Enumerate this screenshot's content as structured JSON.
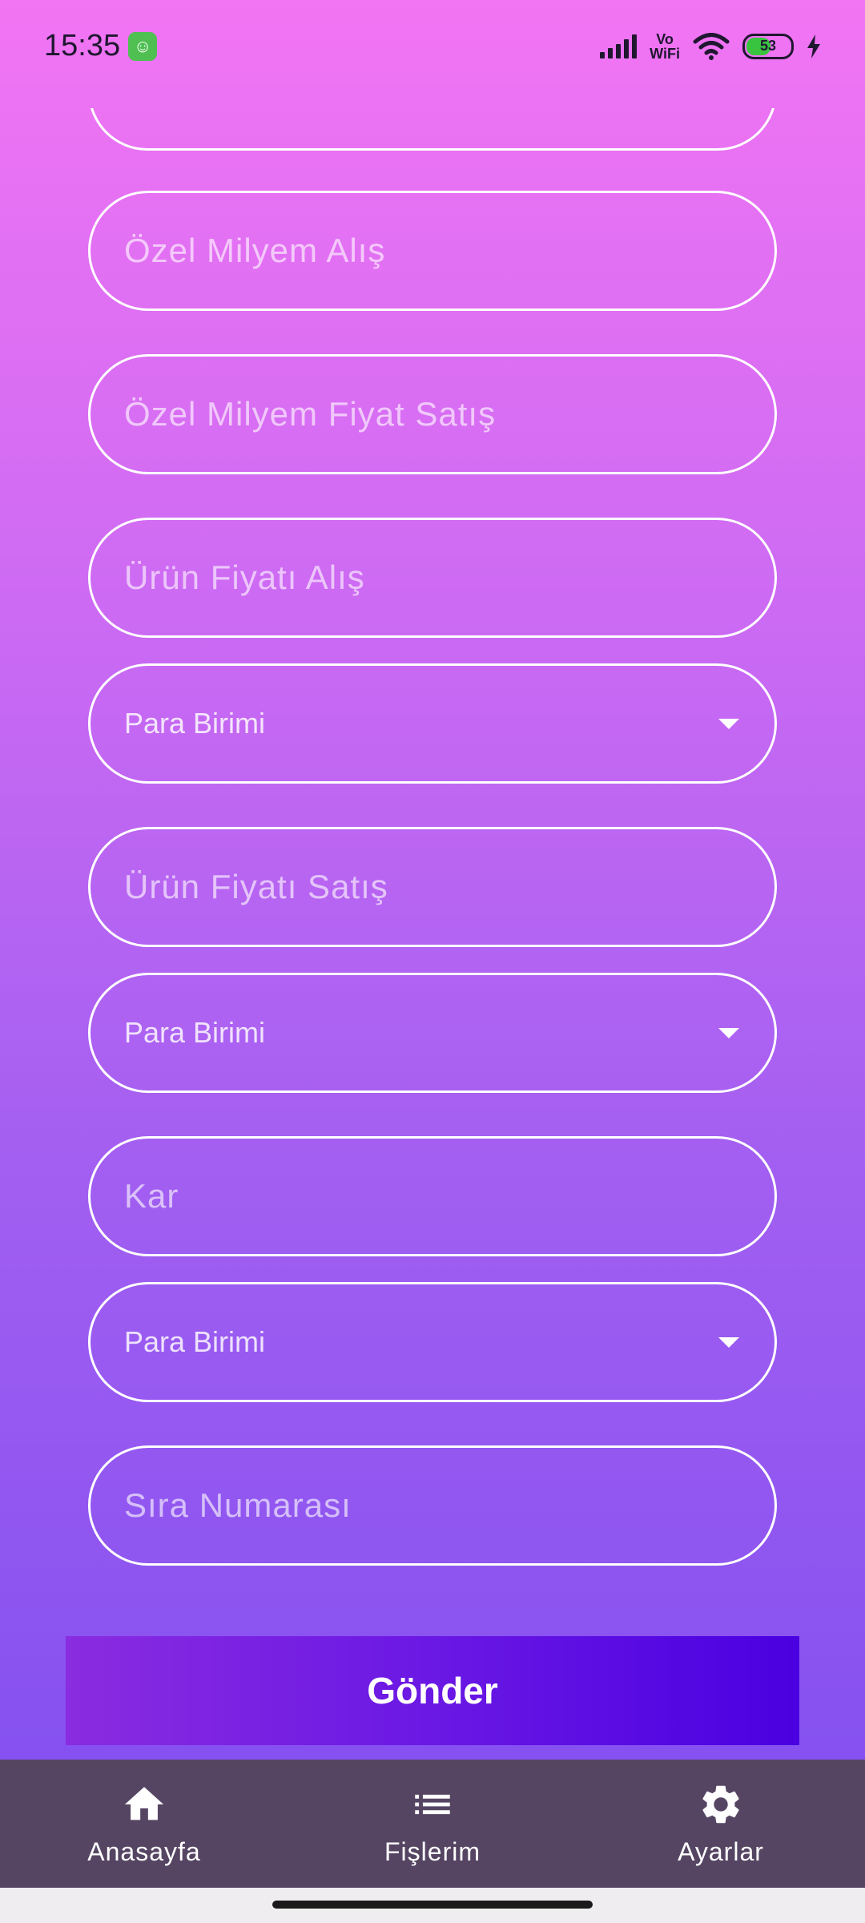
{
  "status_bar": {
    "time": "15:35",
    "net_top": "Vo",
    "net_bottom": "WiFi",
    "battery": "53"
  },
  "fields": [
    {
      "type": "text",
      "placeholder": "Özel Milyem Alış"
    },
    {
      "type": "text",
      "placeholder": "Özel Milyem Fiyat Satış"
    },
    {
      "type": "text",
      "placeholder": "Ürün Fiyatı Alış"
    },
    {
      "type": "dropdown",
      "placeholder": "Para Birimi"
    },
    {
      "type": "text",
      "placeholder": "Ürün Fiyatı Satış"
    },
    {
      "type": "dropdown",
      "placeholder": "Para Birimi"
    },
    {
      "type": "text",
      "placeholder": "Kar"
    },
    {
      "type": "dropdown",
      "placeholder": "Para Birimi"
    },
    {
      "type": "text",
      "placeholder": "Sıra Numarası"
    }
  ],
  "submit_label": "Gönder",
  "nav": [
    {
      "label": "Anasayfa",
      "icon": "home-icon"
    },
    {
      "label": "Fişlerim",
      "icon": "list-icon"
    },
    {
      "label": "Ayarlar",
      "icon": "gear-icon"
    }
  ],
  "colors": {
    "accent_start": "#8a2ce0",
    "accent_end": "#4a00e0",
    "nav_bg": "#554563"
  }
}
